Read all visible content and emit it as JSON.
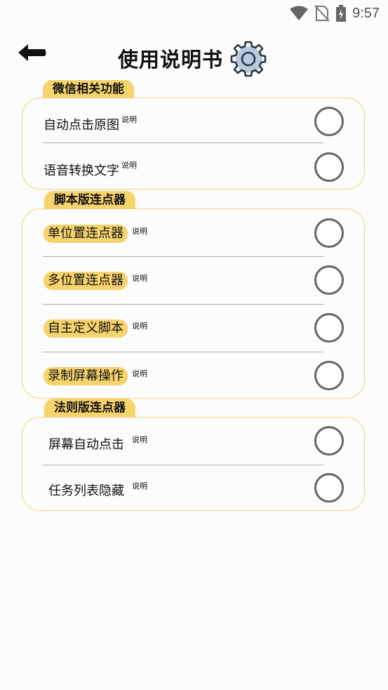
{
  "status": {
    "time": "9:57"
  },
  "header": {
    "title": "使用说明书"
  },
  "sections": [
    {
      "title": "微信相关功能",
      "items": [
        {
          "label": "自动点击原图",
          "note": "说明"
        },
        {
          "label": "语音转换文字",
          "note": "说明"
        }
      ]
    },
    {
      "title": "脚本版连点器",
      "items": [
        {
          "label": "单位置连点器",
          "note": "说明"
        },
        {
          "label": "多位置连点器",
          "note": "说明"
        },
        {
          "label": "自主定义脚本",
          "note": "说明"
        },
        {
          "label": "录制屏幕操作",
          "note": "说明"
        }
      ]
    },
    {
      "title": "法则版连点器",
      "items": [
        {
          "label": "屏幕自动点击",
          "note": "说明"
        },
        {
          "label": "任务列表隐藏",
          "note": "说明"
        }
      ]
    }
  ]
}
